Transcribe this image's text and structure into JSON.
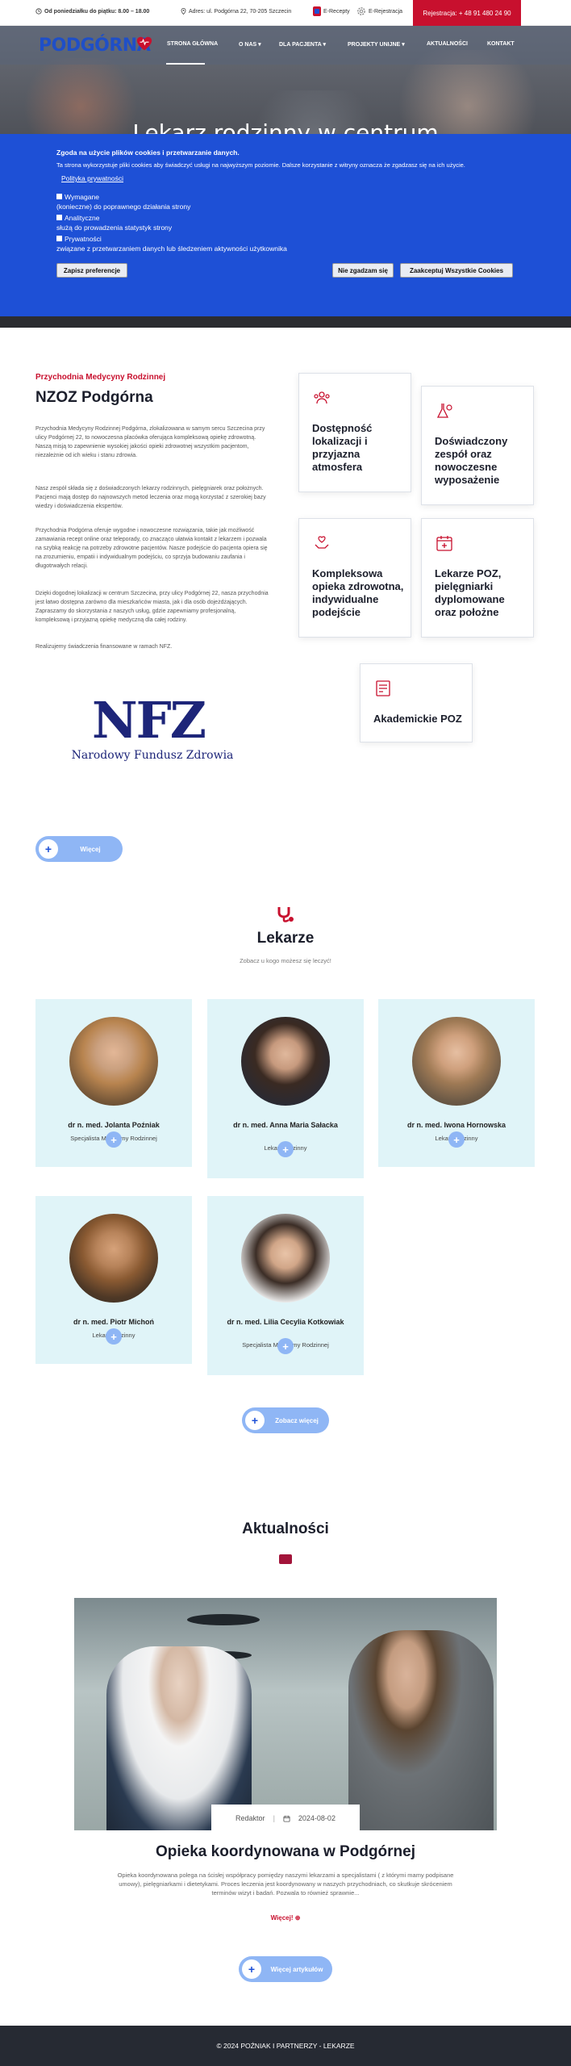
{
  "topbar": {
    "hours": "Od poniedziałku do piątku: 8.00 – 18.00",
    "address": "Adres: ul. Podgórna 22, 70-205 Szczecin",
    "erecepty": "E-Recepty",
    "erejestracja": "E-Rejestracja",
    "registration": "Rejestracja: + 48 91 480 24 90"
  },
  "header": {
    "logo": "PODGÓRNA",
    "nav": [
      "STRONA GŁÓWNA",
      "O NAS",
      "DLA PACJENTA",
      "PROJEKTY UNIJNE",
      "AKTUALNOŚCI",
      "KONTAKT"
    ]
  },
  "hero": {
    "title": "Lekarz rodzinny w centrum"
  },
  "cookie": {
    "title": "Zgoda na użycie plików cookies i przetwarzanie danych.",
    "text": "Ta strona wykorzystuje pliki cookies aby świadczyć usługi na najwyższym poziomie. Dalsze korzystanie z witryny oznacza że zgadzasz się na ich użycie.",
    "policy_link": "Polityka prywatności",
    "options": [
      {
        "name": "Wymagane",
        "desc": "(konieczne) do poprawnego działania strony"
      },
      {
        "name": "Analityczne",
        "desc": "służą do prowadzenia statystyk strony"
      },
      {
        "name": "Prywatności",
        "desc": "związane z przetwarzaniem danych lub śledzeniem aktywności użytkownika"
      }
    ],
    "save_btn": "Zapisz preferencje",
    "reject_btn": "Nie zgadzam się",
    "accept_btn": "Zaakceptuj Wszystkie Cookies"
  },
  "about": {
    "subtitle": "Przychodnia Medycyny Rodzinnej",
    "title": "NZOZ Podgórna",
    "paragraphs": [
      "Przychodnia Medycyny Rodzinnej Podgórna, zlokalizowana w samym sercu Szczecina przy ulicy Podgórnej 22, to nowoczesna placówka oferująca kompleksową opiekę zdrowotną. Naszą misją to zapewnienie wysokiej jakości opieki zdrowotnej wszystkim pacjentom, niezależnie od ich wieku i stanu zdrowia.",
      "Nasz zespół składa się z doświadczonych lekarzy rodzinnych, pielęgniarek oraz położnych. Pacjenci mają dostęp do najnowszych metod leczenia oraz mogą korzystać z szerokiej bazy wiedzy i doświadczenia ekspertów.",
      "Przychodnia Podgórna oferuje wygodne i nowoczesne rozwiązania, takie jak możliwość zamawiania recept online oraz teleporady, co znacząco ułatwia kontakt z lekarzem i pozwala na szybką reakcję na potrzeby zdrowotne pacjentów. Nasze podejście do pacjenta opiera się na zrozumieniu, empatii i indywidualnym podejściu, co sprzyja budowaniu zaufania i długotrwałych relacji.",
      "Dzięki dogodnej lokalizacji w centrum Szczecina, przy ulicy Podgórnej 22, nasza przychodnia jest łatwo dostępna zarówno dla mieszkańców miasta, jak i dla osób dojeżdżających. Zapraszamy do skorzystania z naszych usług, gdzie zapewniamy profesjonalną, kompleksową i przyjazną opiekę medyczną dla całej rodziny.",
      "Realizujemy świadczenia finansowane w ramach NFZ."
    ],
    "nfz_letters": "NFZ",
    "nfz_name": "Narodowy Fundusz Zdrowia",
    "more_btn": "Więcej",
    "cards": [
      {
        "title": "Dostępność lokalizacji i przyjazna atmosfera",
        "icon": "people-icon"
      },
      {
        "title": "Doświadczony zespół oraz nowoczesne wyposażenie",
        "icon": "lab-icon"
      },
      {
        "title": "Kompleksowa opieka zdrowotna, indywidualne podejście",
        "icon": "heart-hands-icon"
      },
      {
        "title": "Lekarze POZ, pielęgniarki dyplomowane oraz położne",
        "icon": "calendar-icon"
      },
      {
        "title": "Akademickie POZ",
        "icon": "certificate-icon"
      }
    ]
  },
  "doctors": {
    "title": "Lekarze",
    "subtitle": "Zobacz u kogo możesz się leczyć!",
    "list": [
      {
        "name": "dr n. med. Jolanta Poźniak",
        "specialty": "Specjalista Medycyny Rodzinnej"
      },
      {
        "name": "dr n. med. Anna Maria Sałacka",
        "specialty": "Lekarz rodzinny"
      },
      {
        "name": "dr n. med. Iwona Hornowska",
        "specialty": "Lekarz rodzinny"
      },
      {
        "name": "dr n. med. Piotr Michoń",
        "specialty": "Lekarz rodzinny"
      },
      {
        "name": "dr n. med. Lilia Cecylia Kotkowiak",
        "specialty": "Specjalista Medycyny Rodzinnej"
      }
    ],
    "more_btn": "Zobacz więcej"
  },
  "news": {
    "title": "Aktualności",
    "author": "Redaktor",
    "date": "2024-08-02",
    "article_title": "Opieka koordynowana w Podgórnej",
    "excerpt": "Opieka koordynowana polega na ścisłej współpracy pomiędzy naszymi lekarzami a specjalistami ( z którymi mamy podpisane umowy), pielęgniarkami i dietetykami. Proces leczenia jest koordynowany w naszych przychodniach, co skutkuje skróceniem terminów wizyt i badań. Pozwala to również sprawnie...",
    "more": "Więcej!",
    "all_btn": "Więcej artykułów"
  },
  "footer": {
    "text": "© 2024 POŹNIAK I PARTNERZY - LEKARZE"
  }
}
